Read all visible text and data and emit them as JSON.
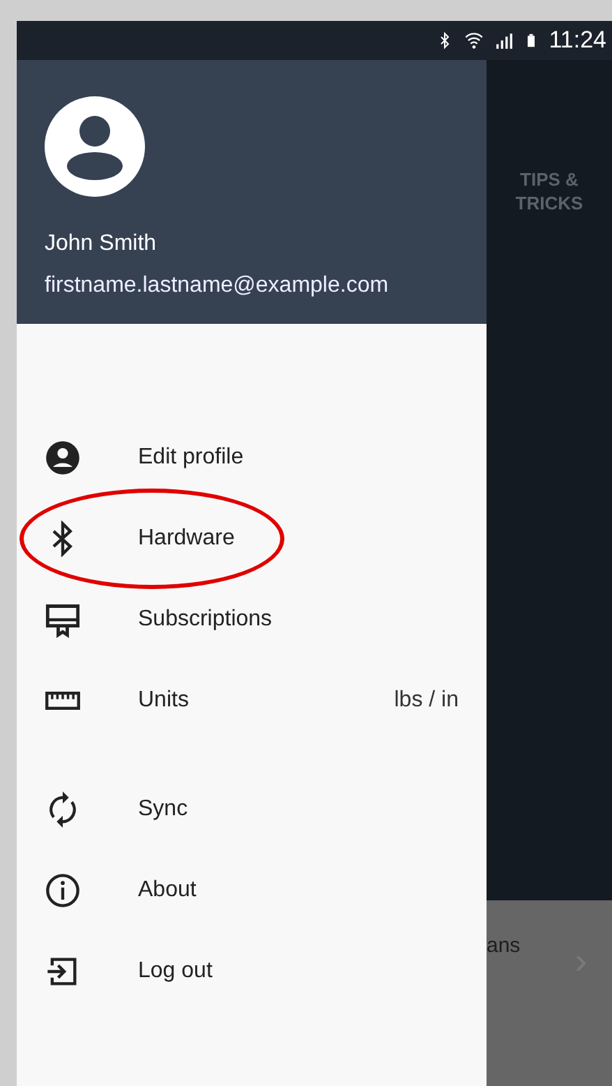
{
  "status_bar": {
    "time": "11:24"
  },
  "background": {
    "tab_label": "TIPS &\nTRICKS",
    "row_text": "ans",
    "row_chevron": "›"
  },
  "drawer": {
    "user": {
      "name": "John Smith",
      "email": "firstname.lastname@example.com"
    },
    "groups": [
      [
        {
          "kind": "profile",
          "label": "Edit profile",
          "annotated": false
        },
        {
          "kind": "bluetooth",
          "label": "Hardware",
          "annotated": true
        },
        {
          "kind": "subscriptions",
          "label": "Subscriptions",
          "annotated": false
        },
        {
          "kind": "ruler",
          "label": "Units",
          "value": "lbs / in",
          "annotated": false
        }
      ],
      [
        {
          "kind": "sync",
          "label": "Sync",
          "annotated": false
        },
        {
          "kind": "info",
          "label": "About",
          "annotated": false
        },
        {
          "kind": "logout",
          "label": "Log out",
          "annotated": false
        }
      ]
    ]
  }
}
